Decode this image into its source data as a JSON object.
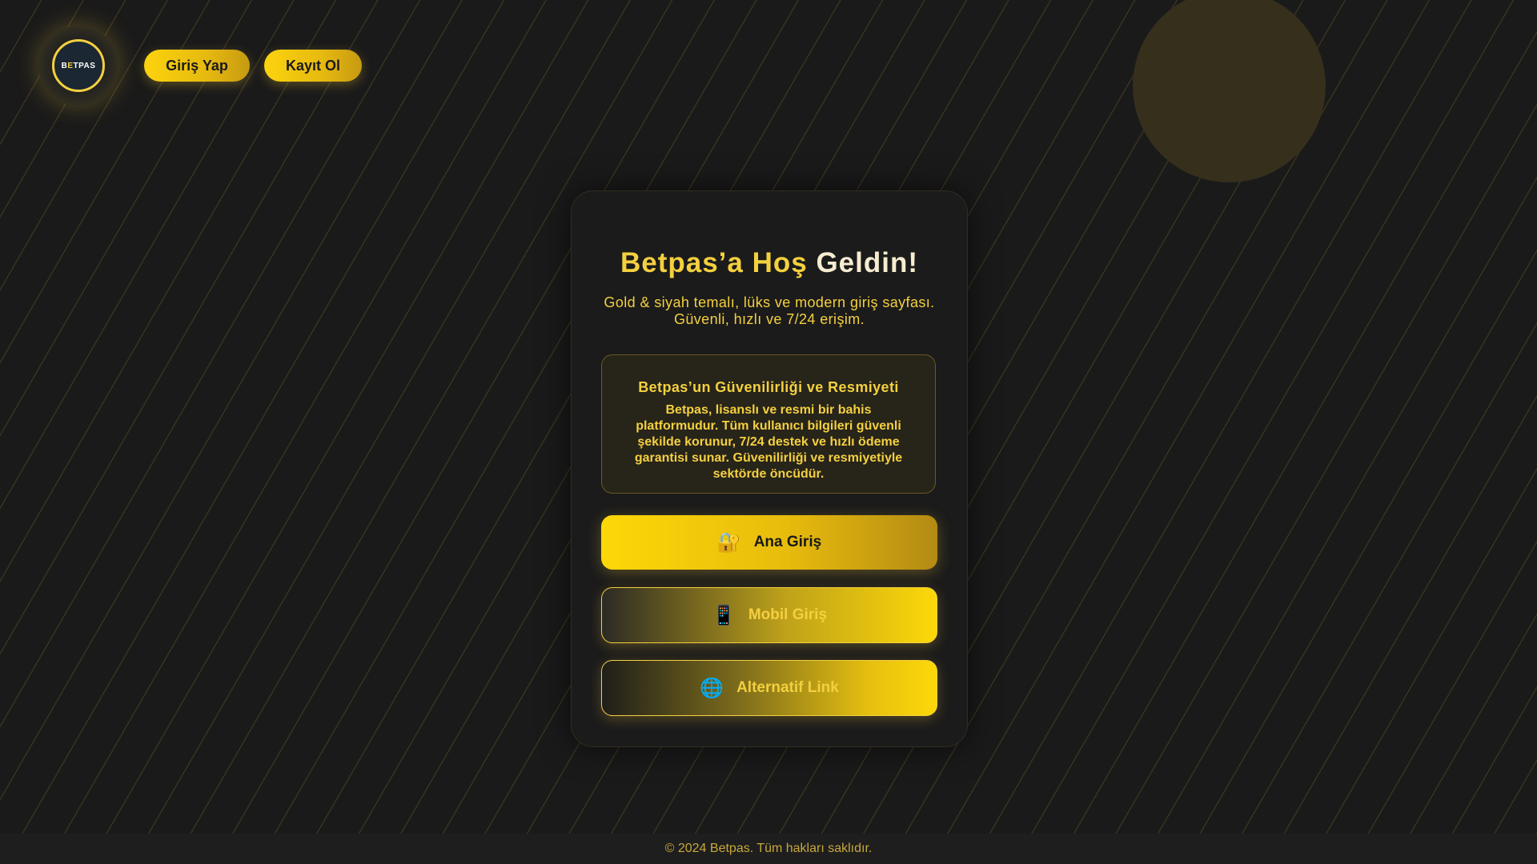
{
  "header": {
    "logo_text_a": "B",
    "logo_text_b": "E",
    "logo_text_c": "TPAS",
    "login_label": "Giriş Yap",
    "register_label": "Kayıt Ol"
  },
  "card": {
    "title_part1": "Betpas’a Hoş",
    "title_part2": "Geldin!",
    "subtitle": "Gold & siyah temalı, lüks ve modern giriş sayfası. Güvenli, hızlı ve 7/24 erişim.",
    "info": {
      "title": "Betpas’un Güvenilirliği ve Resmiyeti",
      "text": "Betpas, lisanslı ve resmi bir bahis platformudur. Tüm kullanıcı bilgileri güvenli şekilde korunur, 7/24 destek ve hızlı ödeme garantisi sunar. Güvenilirliği ve resmiyetiyle sektörde öncüdür."
    },
    "buttons": [
      {
        "icon": "🔐",
        "icon_name": "lock-key-icon",
        "label": "Ana Giriş"
      },
      {
        "icon": "📱",
        "icon_name": "mobile-phone-icon",
        "label": "Mobil Giriş"
      },
      {
        "icon": "🌐",
        "icon_name": "globe-icon",
        "label": "Alternatif Link"
      }
    ]
  },
  "footer": {
    "text": "© 2024 Betpas. Tüm hakları saklıdır."
  },
  "colors": {
    "gold": "#f4d03f",
    "bright_gold": "#fdd808",
    "background": "#1a1a1a",
    "cream": "#f6ecd0"
  }
}
